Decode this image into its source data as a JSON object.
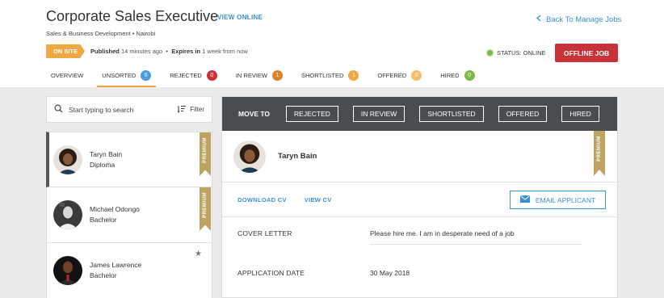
{
  "header": {
    "job_title": "Corporate Sales Executive",
    "view_online": "VIEW ONLINE",
    "back_link": "Back To Manage Jobs",
    "subtitle": "Sales & Business Development • Nairobi",
    "onsite_badge": "ON SITE",
    "published_label": "Published",
    "published_value": "14 minutes ago",
    "expires_label": "Expires in",
    "expires_value": "1 week from now",
    "status_text": "STATUS: ONLINE",
    "offline_button": "OFFLINE JOB"
  },
  "tabs": [
    {
      "label": "OVERVIEW",
      "count": null
    },
    {
      "label": "UNSORTED",
      "count": "6",
      "color": "#4a9be0",
      "active": true
    },
    {
      "label": "REJECTED",
      "count": "0",
      "color": "#c8333a"
    },
    {
      "label": "IN REVIEW",
      "count": "1",
      "color": "#d9822b"
    },
    {
      "label": "SHORTLISTED",
      "count": "1",
      "color": "#f0a742"
    },
    {
      "label": "OFFERED",
      "count": "0",
      "color": "#f3be6a"
    },
    {
      "label": "HIRED",
      "count": "0",
      "color": "#7bb94a"
    }
  ],
  "search": {
    "placeholder": "Start typing to search",
    "filter_label": "Filter"
  },
  "candidates": [
    {
      "name": "Taryn Bain",
      "education": "Diploma",
      "premium": true,
      "selected": true
    },
    {
      "name": "Michael Odongo",
      "education": "Bachelor",
      "premium": true
    },
    {
      "name": "James Lawrence",
      "education": "Bachelor",
      "starred": true
    }
  ],
  "premium_label": "PREMIUM",
  "detail": {
    "move_to_label": "MOVE TO",
    "move_buttons": [
      "REJECTED",
      "IN REVIEW",
      "SHORTLISTED",
      "OFFERED",
      "HIRED"
    ],
    "candidate_name": "Taryn Bain",
    "download_cv": "DOWNLOAD CV",
    "view_cv": "VIEW CV",
    "email_button": "EMAIL APPLICANT",
    "fields": [
      {
        "label": "COVER LETTER",
        "value": "Please hire me. I am in desperate need of a job"
      },
      {
        "label": "APPLICATION DATE",
        "value": "30 May 2018"
      }
    ]
  },
  "colors": {
    "accent_blue": "#3a8fd6",
    "onsite_orange": "#f0a742",
    "offline_red": "#c8333a",
    "online_green": "#7bb94a",
    "premium_gold": "#bda560",
    "move_bar": "#4a4d4f"
  }
}
